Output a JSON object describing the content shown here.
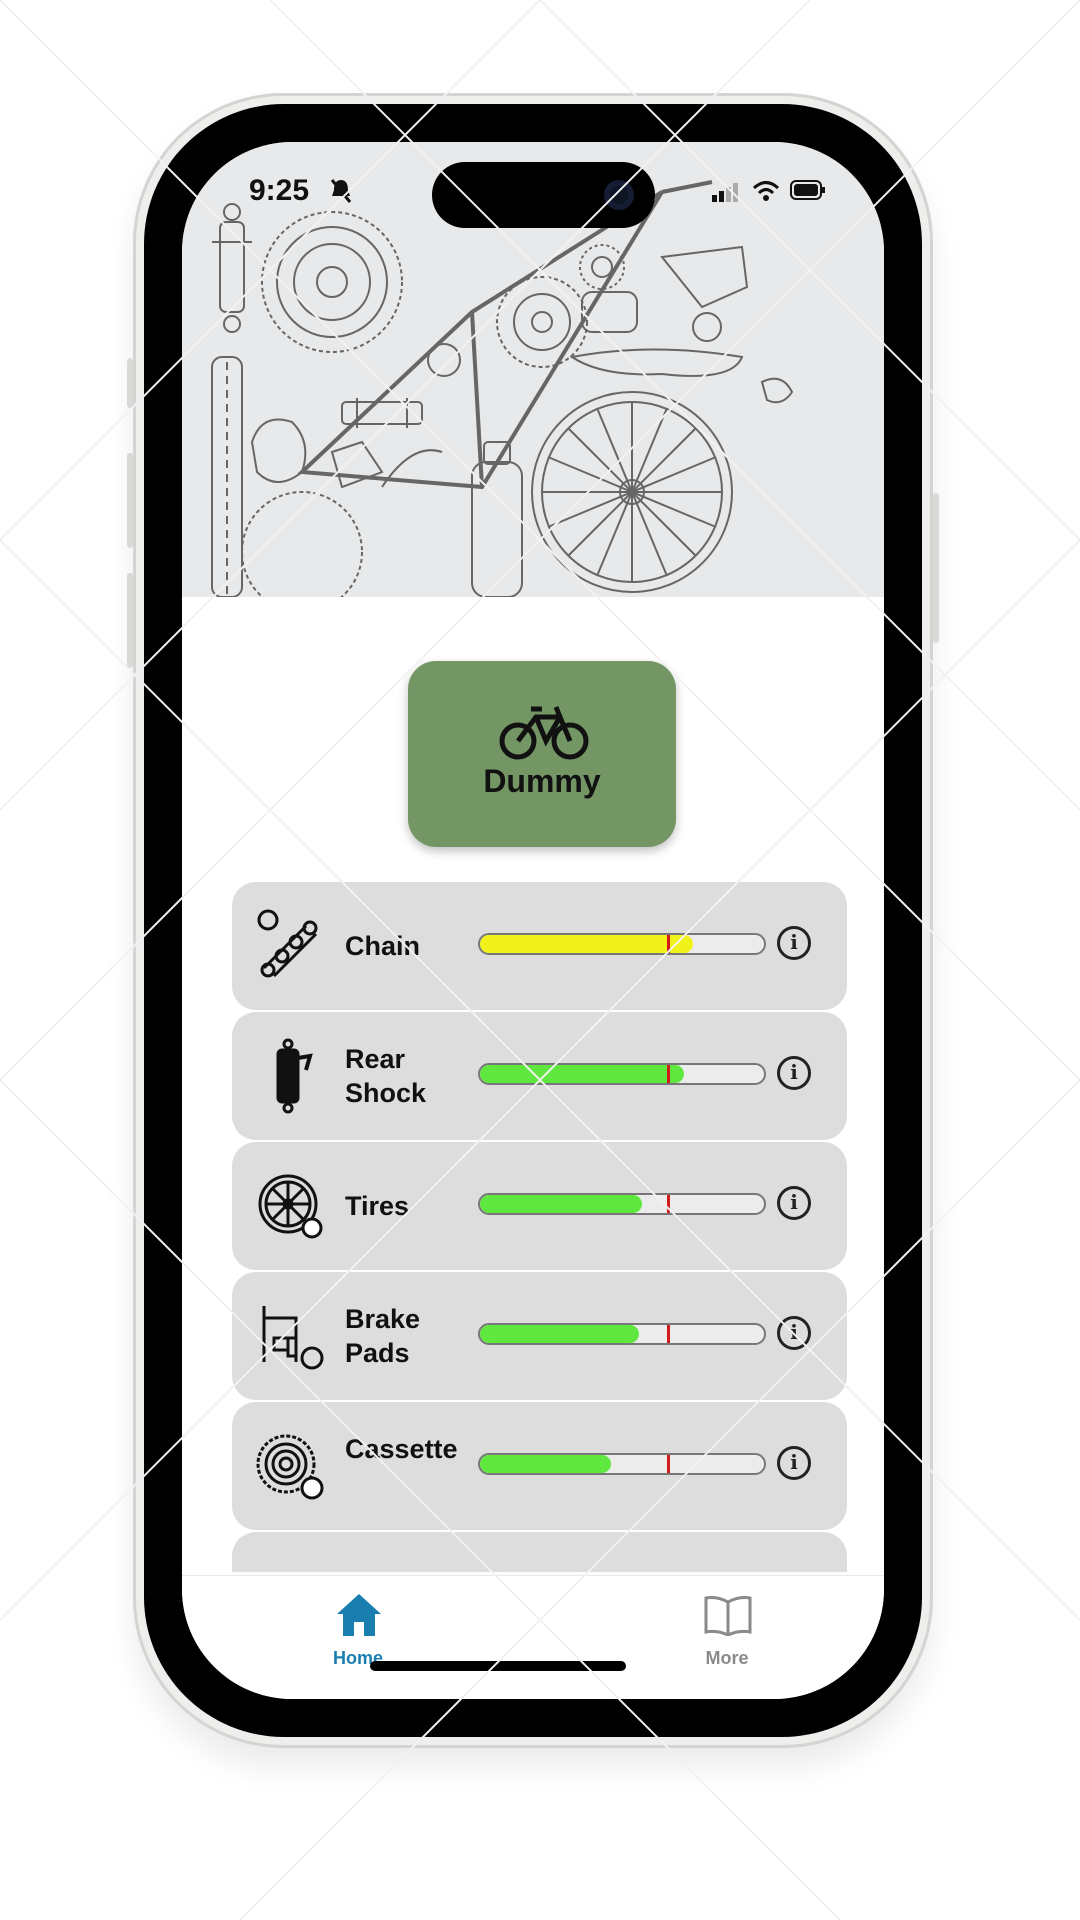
{
  "status_bar": {
    "time": "9:25"
  },
  "bike": {
    "name": "Dummy"
  },
  "components": [
    {
      "name": "Chain",
      "icon": "chain-icon",
      "wear_fraction": 0.75,
      "bar_color": "#f2f21a",
      "alert_threshold_fraction": 0.66
    },
    {
      "name": "Rear Shock",
      "icon": "rear-shock-icon",
      "wear_fraction": 0.72,
      "bar_color": "#5fe63f",
      "alert_threshold_fraction": 0.66
    },
    {
      "name": "Tires",
      "icon": "tire-icon",
      "wear_fraction": 0.57,
      "bar_color": "#5fe63f",
      "alert_threshold_fraction": 0.66
    },
    {
      "name": "Brake Pads",
      "icon": "brake-pads-icon",
      "wear_fraction": 0.56,
      "bar_color": "#5fe63f",
      "alert_threshold_fraction": 0.66
    },
    {
      "name": "Cassette",
      "icon": "cassette-icon",
      "wear_fraction": 0.46,
      "bar_color": "#5fe63f",
      "alert_threshold_fraction": 0.66
    }
  ],
  "tabs": [
    {
      "label": "Home",
      "icon": "home-icon",
      "active": true,
      "color": "#1a7fb0"
    },
    {
      "label": "More",
      "icon": "book-icon",
      "active": false,
      "color": "#8a8a8a"
    }
  ]
}
